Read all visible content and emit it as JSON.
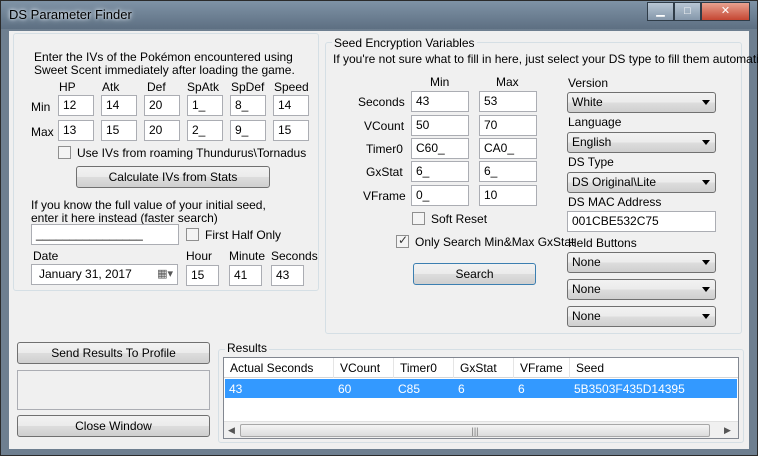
{
  "window": {
    "title": "DS Parameter Finder",
    "buttons": {
      "minimize": "▁",
      "maximize": "□",
      "close": "✕"
    }
  },
  "ivs": {
    "instructions_line1": "Enter the IVs of the Pokémon encountered using",
    "instructions_line2": "Sweet Scent immediately after loading the game.",
    "stat_headers": [
      "HP",
      "Atk",
      "Def",
      "SpAtk",
      "SpDef",
      "Speed"
    ],
    "min_label": "Min",
    "max_label": "Max",
    "min_values": [
      "12",
      "14",
      "20",
      "1_",
      "8_",
      "14"
    ],
    "max_values": [
      "13",
      "15",
      "20",
      "2_",
      "9_",
      "15"
    ],
    "roaming_checkbox_label": "Use IVs from roaming Thundurus\\Tornadus",
    "roaming_checked": false,
    "calculate_button": "Calculate IVs from Stats"
  },
  "seed": {
    "hint_line1": "If you know the full value of your initial seed,",
    "hint_line2": "enter it here instead (faster search)",
    "seed_value": "________________",
    "first_half_label": "First Half Only",
    "first_half_checked": false,
    "date_label": "Date",
    "date_value": "January   31, 2017",
    "hour_label": "Hour",
    "hour_value": "15",
    "minute_label": "Minute",
    "minute_value": "41",
    "seconds_label": "Seconds",
    "seconds_value": "43"
  },
  "encryption": {
    "group_title": "Seed Encryption Variables",
    "hint": "If you're not sure what to fill in here, just select your DS type to fill them automatically.",
    "min_header": "Min",
    "max_header": "Max",
    "rows": [
      {
        "label": "Seconds",
        "min": "43",
        "max": "53"
      },
      {
        "label": "VCount",
        "min": "50",
        "max": "70"
      },
      {
        "label": "Timer0",
        "min": "C60_",
        "max": "CA0_"
      },
      {
        "label": "GxStat",
        "min": "6_",
        "max": "6_"
      },
      {
        "label": "VFrame",
        "min": "0_",
        "max": "10"
      }
    ],
    "soft_reset_label": "Soft Reset",
    "soft_reset_checked": false,
    "only_search_label": "Only Search Min&Max GxStat",
    "only_search_checked": true,
    "search_button": "Search",
    "version_label": "Version",
    "version_value": "White",
    "language_label": "Language",
    "language_value": "English",
    "ds_type_label": "DS Type",
    "ds_type_value": "DS Original\\Lite",
    "mac_label": "DS MAC Address",
    "mac_value": "001CBE532C75",
    "held_buttons_label": "Held Buttons",
    "held_buttons": [
      "None",
      "None",
      "None"
    ]
  },
  "bottom": {
    "send_results_button": "Send Results To Profile",
    "close_window_button": "Close Window"
  },
  "results": {
    "group_title": "Results",
    "columns": [
      "Actual Seconds",
      "VCount",
      "Timer0",
      "GxStat",
      "VFrame",
      "Seed"
    ],
    "rows": [
      [
        "43",
        "60",
        "C85",
        "6",
        "6",
        "5B3503F435D14395"
      ]
    ],
    "scroll_left": "◀",
    "scroll_right": "▶",
    "scroll_grip": "|||"
  },
  "colors": {
    "selection": "#3399ff",
    "window_frame": "#6e7f90",
    "client_bg": "#f0f0f0"
  }
}
